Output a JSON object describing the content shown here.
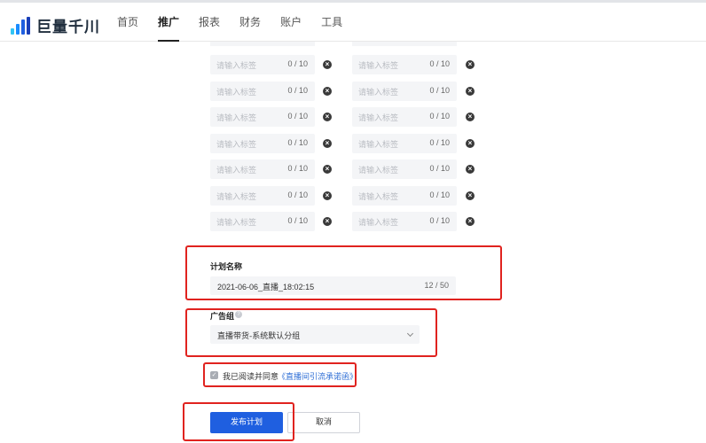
{
  "header": {
    "logo_text": "巨量千川",
    "nav": [
      {
        "label": "首页",
        "active": false
      },
      {
        "label": "推广",
        "active": true
      },
      {
        "label": "报表",
        "active": false
      },
      {
        "label": "财务",
        "active": false
      },
      {
        "label": "账户",
        "active": false
      },
      {
        "label": "工具",
        "active": false
      }
    ]
  },
  "tags": {
    "placeholder": "请输入标签",
    "count": "0 / 10",
    "rows": 7,
    "columns": 2
  },
  "plan_name": {
    "label": "计划名称",
    "value": "2021-06-06_直播_18:02:15",
    "count": "12 / 50"
  },
  "ad_group": {
    "label": "广告组",
    "selected": "直播带货-系统默认分组"
  },
  "agreement": {
    "text": "我已阅读并同意",
    "link": "《直播间引流承诺函》",
    "checked": true
  },
  "actions": {
    "publish": "发布计划",
    "cancel": "取消"
  },
  "colors": {
    "primary": "#1f5fe0",
    "annotation": "#e0231f",
    "input_bg": "#f4f5f7",
    "link": "#2f6fd6"
  },
  "icons": {
    "logo": "bar-chart-logo-icon",
    "remove": "close-circle-icon",
    "help": "question-icon",
    "dropdown": "chevron-down-icon",
    "checkbox": "check-icon"
  }
}
